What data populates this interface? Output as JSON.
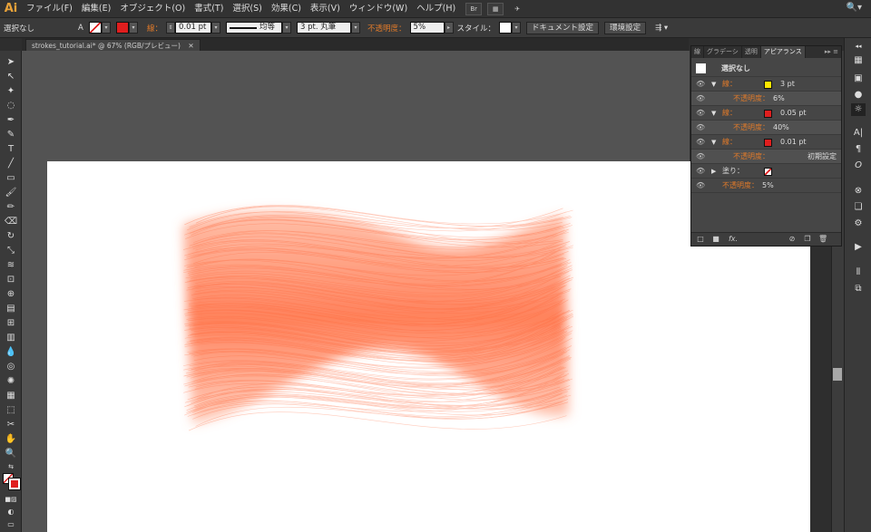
{
  "app": {
    "logo": "Ai"
  },
  "menubar": {
    "items": [
      "ファイル(F)",
      "編集(E)",
      "オブジェクト(O)",
      "書式(T)",
      "選択(S)",
      "効果(C)",
      "表示(V)",
      "ウィンドウ(W)",
      "ヘルプ(H)"
    ],
    "bridge_label": "Br",
    "workspace_icon": "grid-icon",
    "search_icon": "search-icon"
  },
  "controlbar": {
    "selection_label": "選択なし",
    "stroke_label": "線：",
    "stroke_weight": "0.01 pt",
    "stroke_style": "均等",
    "brush_label": "3 pt. 丸筆",
    "opacity_label": "不透明度：",
    "opacity_value": "5%",
    "style_label": "スタイル：",
    "doc_setup_button": "ドキュメント設定",
    "prefs_button": "環境設定"
  },
  "document": {
    "tab_title": "strokes_tutorial.ai* @ 67% (RGB/プレビュー)",
    "artwork_color": "#ff6a3d"
  },
  "panel": {
    "tabs": [
      "線",
      "グラデーシ",
      "透明",
      "アピアランス"
    ],
    "active_tab": "アピアランス",
    "header": "選択なし",
    "rows": [
      {
        "type": "stroke",
        "label": "線：",
        "color": "#ffe600",
        "value": "3 pt"
      },
      {
        "type": "opacity",
        "label": "不透明度：",
        "value": "6%"
      },
      {
        "type": "stroke",
        "label": "線：",
        "color": "#e01e1e",
        "value": "0.05 pt"
      },
      {
        "type": "opacity",
        "label": "不透明度：",
        "value": "40%"
      },
      {
        "type": "stroke",
        "label": "線：",
        "color": "#e01e1e",
        "value": "0.01 pt"
      },
      {
        "type": "opacity",
        "label": "不透明度：",
        "value": "初期設定"
      },
      {
        "type": "fill",
        "label": "塗り：",
        "value": ""
      },
      {
        "type": "opacity-top",
        "label": "不透明度：",
        "value": "5%"
      }
    ],
    "fx_label": "fx."
  },
  "colors": {
    "accent_orange": "#e07a2a"
  }
}
